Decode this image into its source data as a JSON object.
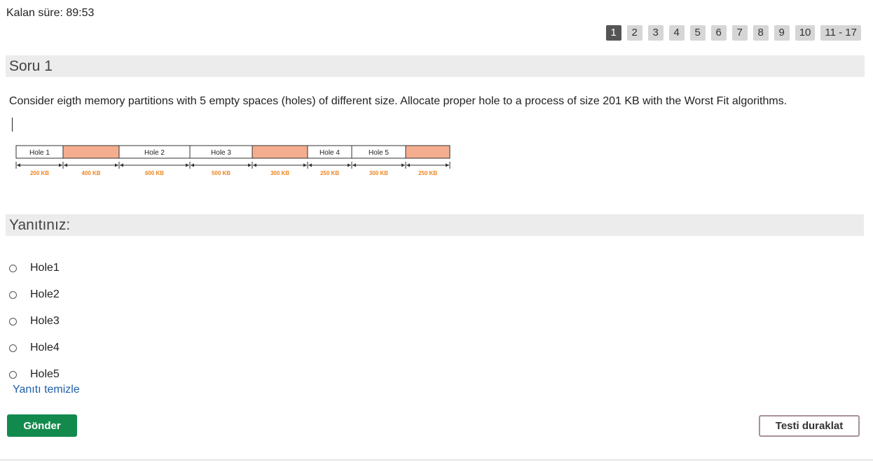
{
  "timer": {
    "text": "Kalan süre: 89:53"
  },
  "pager": {
    "pages": [
      "1",
      "2",
      "3",
      "4",
      "5",
      "6",
      "7",
      "8",
      "9",
      "10",
      "11 - 17"
    ],
    "active_index": 0
  },
  "question": {
    "header": "Soru 1",
    "text": "Consider eigth memory partitions with 5 empty spaces (holes) of different size. Allocate proper hole to a process of size 201 KB with the Worst Fit algorithms."
  },
  "diagram": {
    "segments": [
      {
        "label": "Hole 1",
        "size": "200 KB",
        "kind": "hole"
      },
      {
        "label": "",
        "size": "400 KB",
        "kind": "allocated"
      },
      {
        "label": "Hole 2",
        "size": "600 KB",
        "kind": "hole"
      },
      {
        "label": "Hole 3",
        "size": "500 KB",
        "kind": "hole"
      },
      {
        "label": "",
        "size": "300 KB",
        "kind": "allocated"
      },
      {
        "label": "Hole 4",
        "size": "250 KB",
        "kind": "hole"
      },
      {
        "label": "Hole 5",
        "size": "300 KB",
        "kind": "hole"
      },
      {
        "label": "",
        "size": "250 KB",
        "kind": "allocated"
      }
    ],
    "colors": {
      "allocated": "#f4ae8f",
      "hole": "#ffffff",
      "size_text": "#f0841e",
      "border": "#333333"
    }
  },
  "answer": {
    "header": "Yanıtınız:",
    "options": [
      "Hole1",
      "Hole2",
      "Hole3",
      "Hole4",
      "Hole5"
    ],
    "clear_label": "Yanıtı temizle"
  },
  "buttons": {
    "submit": "Gönder",
    "pause": "Testi duraklat"
  }
}
